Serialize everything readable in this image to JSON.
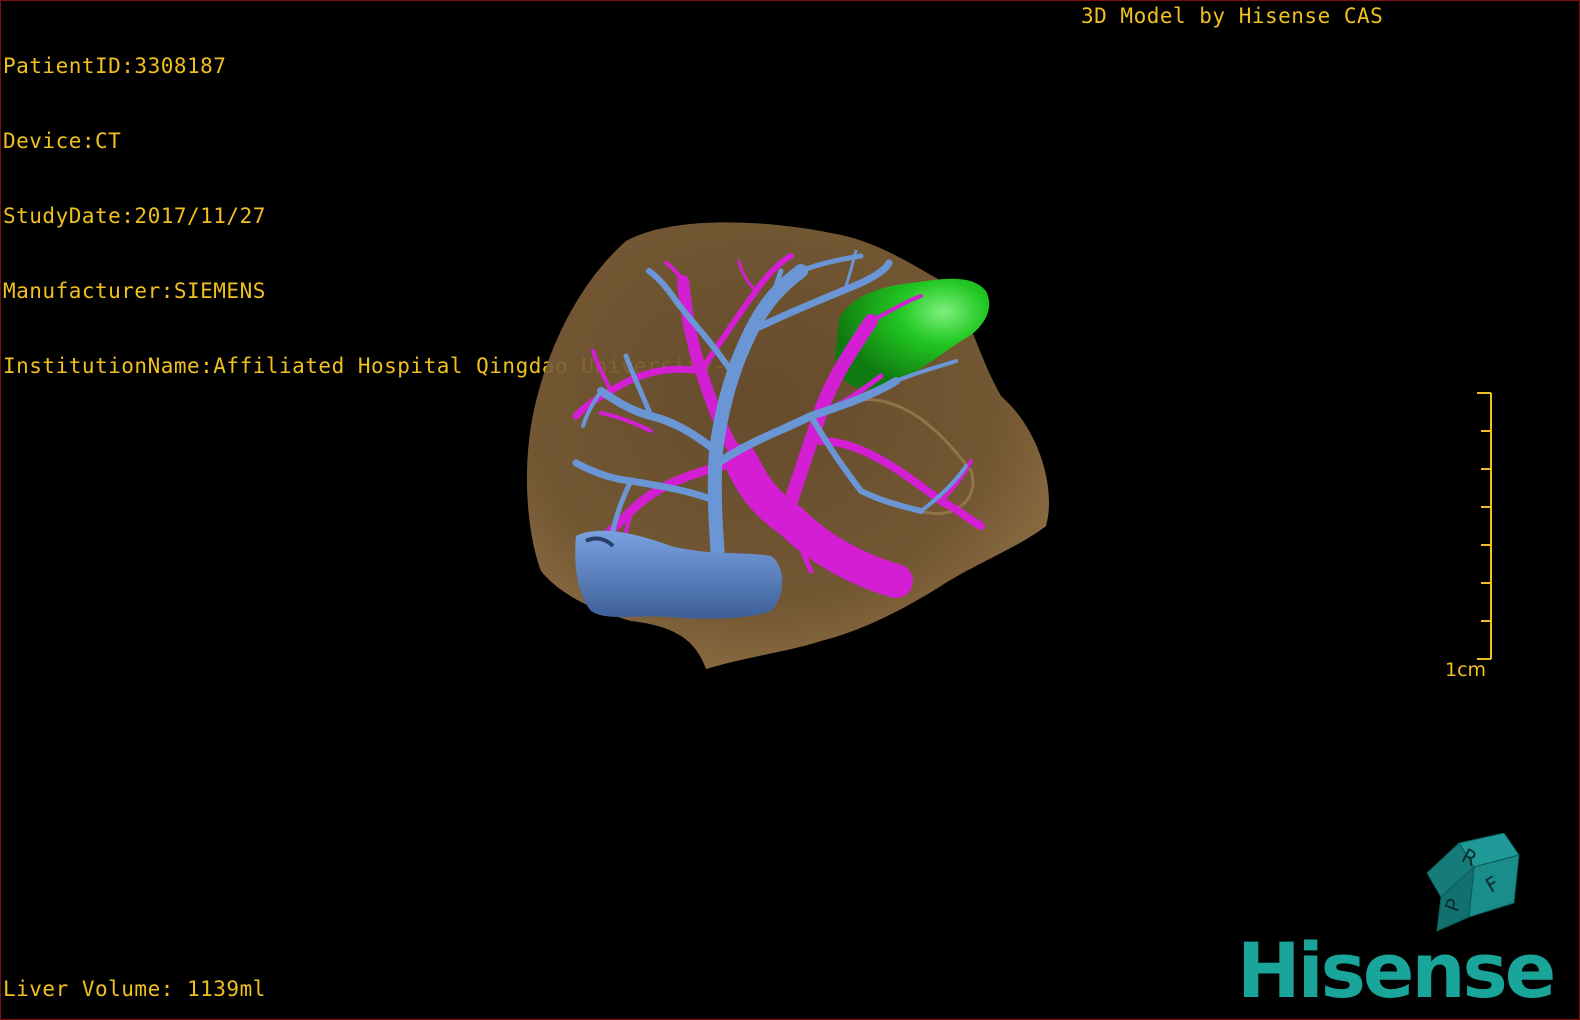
{
  "dicom_info": {
    "patient_id": "PatientID:3308187",
    "device": "Device:CT",
    "study_date": "StudyDate:2017/11/27",
    "manufacturer": "Manufacturer:SIEMENS",
    "institution": "InstitutionName:Affiliated Hospital Qingdao University-C"
  },
  "header_right": "3D Model by Hisense CAS",
  "footer": {
    "liver_volume": "Liver Volume: 1139ml"
  },
  "scale_bar": {
    "label": "1cm"
  },
  "orientation_cube": {
    "top": "R",
    "right": "F",
    "left": "P",
    "color": "#1a8c8a"
  },
  "logo": {
    "text": "Hisense",
    "color": "#1aa59a"
  },
  "colors": {
    "overlay_text": "#f0c020",
    "liver": "#8a6a40",
    "hepatic_vein": "#6b96d6",
    "portal_vein": "#d020d0",
    "gallbladder": "#20c020",
    "border": "#7a1010"
  }
}
